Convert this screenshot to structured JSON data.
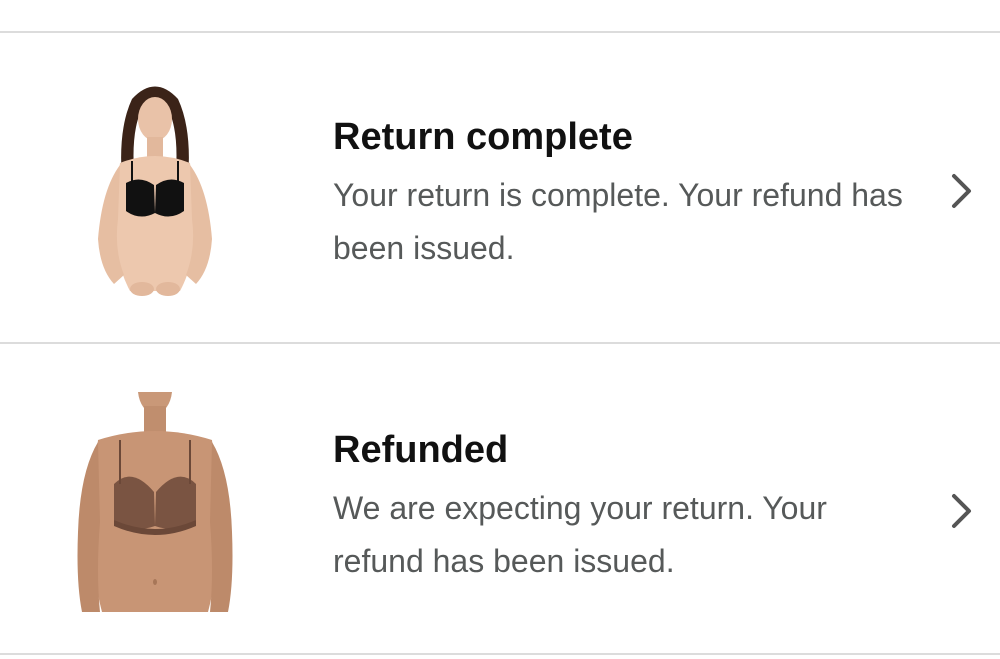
{
  "returns": [
    {
      "status": "Return complete",
      "description": "Your return is complete. Your refund has been issued.",
      "image": "black-bra-product-image",
      "chevron_icon": "chevron-right-icon"
    },
    {
      "status": "Refunded",
      "description": "We are expecting your return. Your refund has been issued.",
      "image": "nude-lace-bra-product-image",
      "chevron_icon": "chevron-right-icon"
    }
  ],
  "colors": {
    "divider": "#dcdcdc",
    "title": "#111111",
    "description": "#565959",
    "chevron": "#555555"
  }
}
